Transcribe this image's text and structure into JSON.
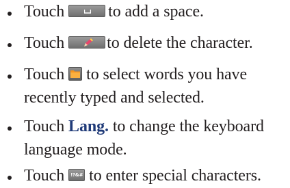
{
  "items": [
    {
      "before": "Touch",
      "icon": "space-key-icon",
      "after": "to add a space."
    },
    {
      "before": "Touch",
      "icon": "delete-key-icon",
      "after": "to delete the character."
    },
    {
      "before": "Touch",
      "icon": "folder-key-icon",
      "after": "to select words you have",
      "line2": "recently typed and selected."
    },
    {
      "before": "Touch",
      "bold": "Lang.",
      "after": "to change the keyboard",
      "line2": "language mode."
    },
    {
      "before": "Touch",
      "icon": "symbol-key-icon",
      "icon_label": "!?&#",
      "after": "to enter special characters."
    }
  ],
  "colors": {
    "text": "#231f20",
    "bold_word": "#1f3a78",
    "key_gray": "#7f7f7f",
    "folder_orange": "#f7941d",
    "pencil_pink": "#e8456b"
  }
}
